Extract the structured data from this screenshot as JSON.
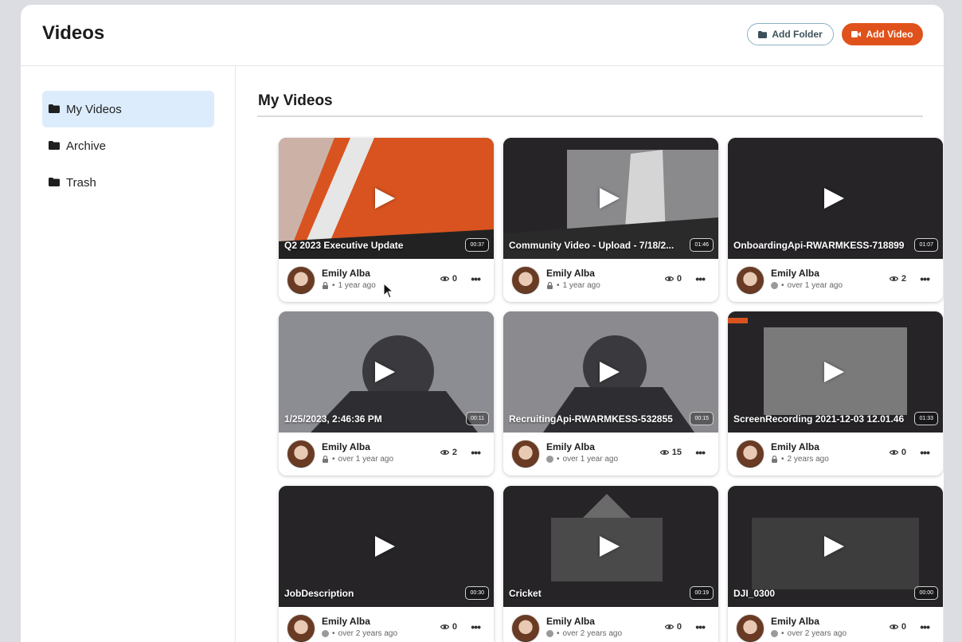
{
  "header": {
    "title": "Videos",
    "add_folder_label": "Add Folder",
    "add_video_label": "Add Video",
    "accent_color": "#e0521b"
  },
  "sidebar": {
    "items": [
      {
        "label": "My Videos",
        "icon": "folder-icon",
        "active": true
      },
      {
        "label": "Archive",
        "icon": "folder-icon",
        "active": false
      },
      {
        "label": "Trash",
        "icon": "folder-icon",
        "active": false
      }
    ]
  },
  "main": {
    "section_title": "My Videos",
    "videos": [
      {
        "title": "Q2 2023 Executive Update",
        "duration": "00:37",
        "author": "Emily Alba",
        "privacy": "lock-icon",
        "age": "1 year ago",
        "views": "0"
      },
      {
        "title": "Community Video - Upload - 7/18/2...",
        "duration": "01:46",
        "author": "Emily Alba",
        "privacy": "lock-icon",
        "age": "1 year ago",
        "views": "0"
      },
      {
        "title": "OnboardingApi-RWARMKESS-718899",
        "duration": "01:07",
        "author": "Emily Alba",
        "privacy": "globe-icon",
        "age": "over 1 year ago",
        "views": "2"
      },
      {
        "title": "1/25/2023, 2:46:36 PM",
        "duration": "00:11",
        "author": "Emily Alba",
        "privacy": "lock-icon",
        "age": "over 1 year ago",
        "views": "2"
      },
      {
        "title": "RecruitingApi-RWARMKESS-532855",
        "duration": "00:15",
        "author": "Emily Alba",
        "privacy": "globe-icon",
        "age": "over 1 year ago",
        "views": "15"
      },
      {
        "title": "ScreenRecording 2021-12-03 12.01.46",
        "duration": "01:33",
        "author": "Emily Alba",
        "privacy": "lock-icon",
        "age": "2 years ago",
        "views": "0"
      },
      {
        "title": "JobDescription",
        "duration": "00:30",
        "author": "Emily Alba",
        "privacy": "globe-icon",
        "age": "over 2 years ago",
        "views": "0"
      },
      {
        "title": "Cricket",
        "duration": "00:19",
        "author": "Emily Alba",
        "privacy": "globe-icon",
        "age": "over 2 years ago",
        "views": "0"
      },
      {
        "title": "DJI_0300",
        "duration": "00:00",
        "author": "Emily Alba",
        "privacy": "globe-icon",
        "age": "over 2 years ago",
        "views": "0"
      }
    ]
  }
}
